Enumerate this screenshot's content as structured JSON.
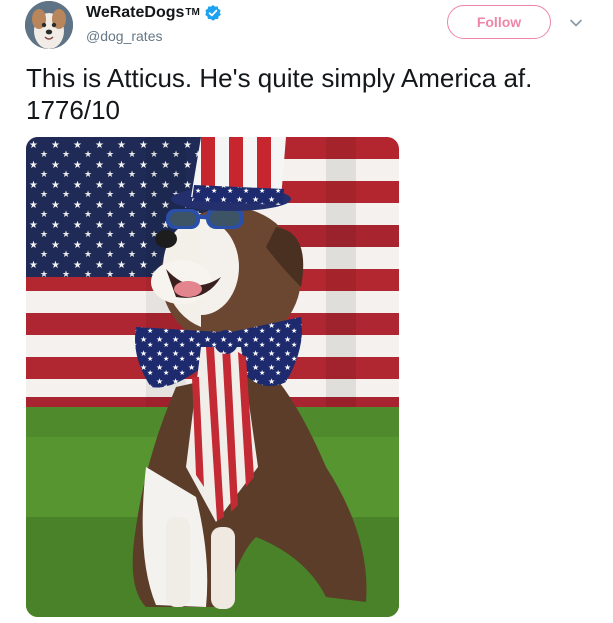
{
  "account": {
    "display_name": "WeRateDogs",
    "trademark": "TM",
    "handle": "@dog_rates",
    "verified_icon": "verified-badge-icon"
  },
  "actions": {
    "follow_label": "Follow",
    "menu_icon": "chevron-down-icon"
  },
  "tweet": {
    "line1": "This is Atticus. He's quite simply America af.",
    "line2": "1776/10"
  },
  "colors": {
    "follow_accent": "#e0245e",
    "verified_blue": "#1da1f2",
    "text_primary": "#14171a",
    "text_secondary": "#657786"
  }
}
